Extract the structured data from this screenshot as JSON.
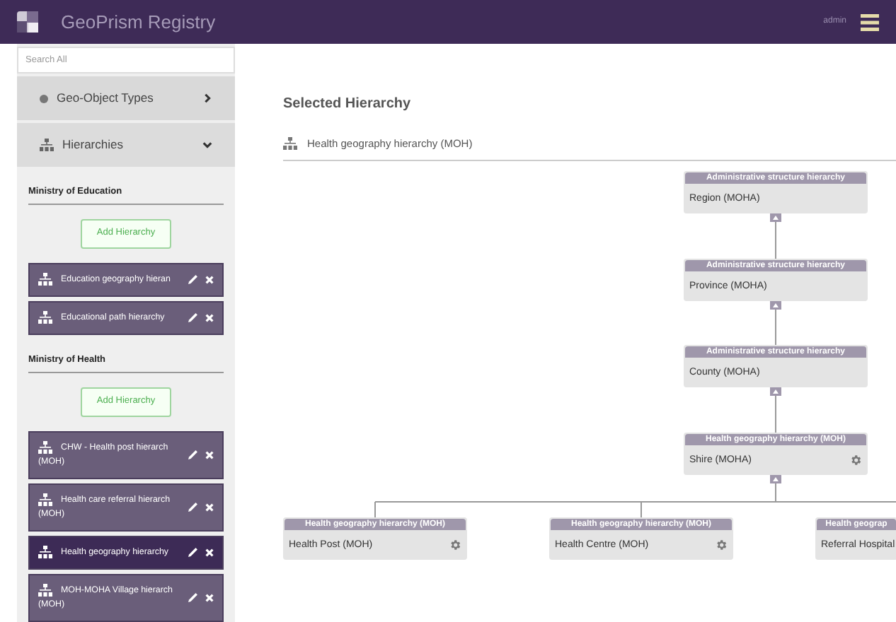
{
  "header": {
    "title": "GeoPrism Registry",
    "user": "admin"
  },
  "search": {
    "placeholder": "Search All"
  },
  "nav": [
    {
      "label": "Geo-Object Types",
      "expanded": false,
      "kind": "dot"
    },
    {
      "label": "Hierarchies",
      "expanded": true,
      "kind": "tree"
    }
  ],
  "groups": [
    {
      "name": "Ministry of Education",
      "add_button": "Add Hierarchy",
      "items": [
        {
          "lines": [
            "Education geography hieran"
          ],
          "selected": false
        },
        {
          "lines": [
            "Educational path hierarchy"
          ],
          "selected": false
        }
      ]
    },
    {
      "name": "Ministry of Health",
      "add_button": "Add Hierarchy",
      "items": [
        {
          "lines": [
            "CHW - Health post hierarch",
            "(MOH)"
          ],
          "selected": false
        },
        {
          "lines": [
            "Health care referral hierarch",
            "(MOH)"
          ],
          "selected": false
        },
        {
          "lines": [
            "Health geography hierarchy"
          ],
          "selected": true
        },
        {
          "lines": [
            "MOH-MOHA Village hierarch",
            "(MOH)"
          ],
          "selected": false
        }
      ]
    }
  ],
  "main": {
    "title": "Selected Hierarchy",
    "hierarchy": "Health geography hierarchy (MOH)"
  },
  "nodes": [
    {
      "header": "Administrative structure hierarchy",
      "label": "Region (MOHA)",
      "settings": false,
      "collapsible": true
    },
    {
      "header": "Administrative structure hierarchy",
      "label": "Province (MOHA)",
      "settings": false,
      "collapsible": true
    },
    {
      "header": "Administrative structure hierarchy",
      "label": "County (MOHA)",
      "settings": false,
      "collapsible": true
    },
    {
      "header": "Health geography hierarchy (MOH)",
      "label": "Shire (MOHA)",
      "settings": true,
      "collapsible": true
    },
    {
      "header": "Health geography hierarchy (MOH)",
      "label": "Health Post (MOH)",
      "settings": true,
      "collapsible": false
    },
    {
      "header": "Health geography hierarchy (MOH)",
      "label": "Health Centre (MOH)",
      "settings": true,
      "collapsible": false
    },
    {
      "header": "Health geograp",
      "label": "Referral Hospital",
      "collapsible": false
    }
  ]
}
